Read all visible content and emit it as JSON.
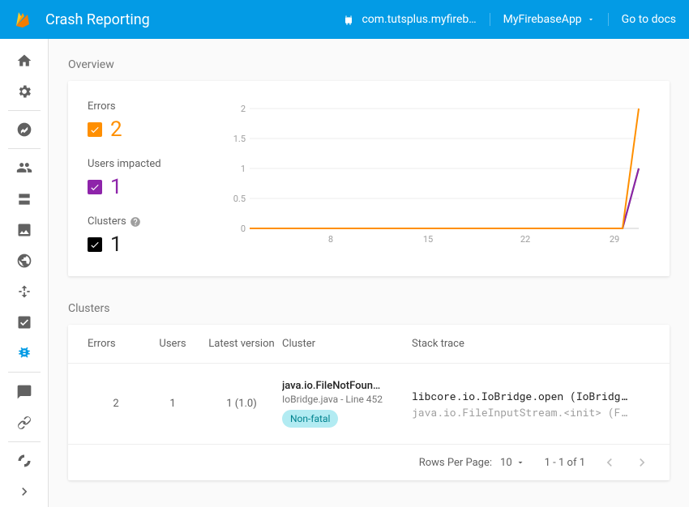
{
  "header": {
    "title": "Crash Reporting",
    "package": "com.tutsplus.myfireb…",
    "app_name": "MyFirebaseApp",
    "docs_link": "Go to docs"
  },
  "overview": {
    "label": "Overview",
    "metrics": {
      "errors": {
        "label": "Errors",
        "value": "2"
      },
      "users": {
        "label": "Users impacted",
        "value": "1"
      },
      "clusters": {
        "label": "Clusters",
        "value": "1"
      }
    }
  },
  "chart_data": {
    "type": "line",
    "x": [
      1,
      8,
      15,
      22,
      29,
      30
    ],
    "x_ticks": [
      "8",
      "15",
      "22",
      "29"
    ],
    "ylim": [
      0,
      2
    ],
    "y_ticks": [
      "0",
      "0.5",
      "1",
      "1.5",
      "2"
    ],
    "series": [
      {
        "name": "Errors",
        "color": "#ff8f00",
        "values": [
          0,
          0,
          0,
          0,
          0,
          2
        ]
      },
      {
        "name": "Users impacted",
        "color": "#8e24aa",
        "values": [
          0,
          0,
          0,
          0,
          0,
          1
        ]
      },
      {
        "name": "Clusters",
        "color": "#000000",
        "values": [
          0,
          0,
          0,
          0,
          0,
          1
        ]
      }
    ]
  },
  "clusters": {
    "label": "Clusters",
    "columns": {
      "errors": "Errors",
      "users": "Users",
      "version": "Latest version",
      "cluster": "Cluster",
      "stack": "Stack trace"
    },
    "rows": [
      {
        "errors": "2",
        "users": "1",
        "version": "1 (1.0)",
        "cluster_title": "java.io.FileNotFoun…",
        "cluster_sub": "IoBridge.java - Line 452",
        "tag": "Non-fatal",
        "stack_main": "libcore.io.IoBridge.open (IoBridge.…",
        "stack_sub": "java.io.FileInputStream.<init> (Fil…"
      }
    ],
    "footer": {
      "rpp_label": "Rows Per Page:",
      "rpp_value": "10",
      "range": "1 - 1 of  1"
    }
  }
}
